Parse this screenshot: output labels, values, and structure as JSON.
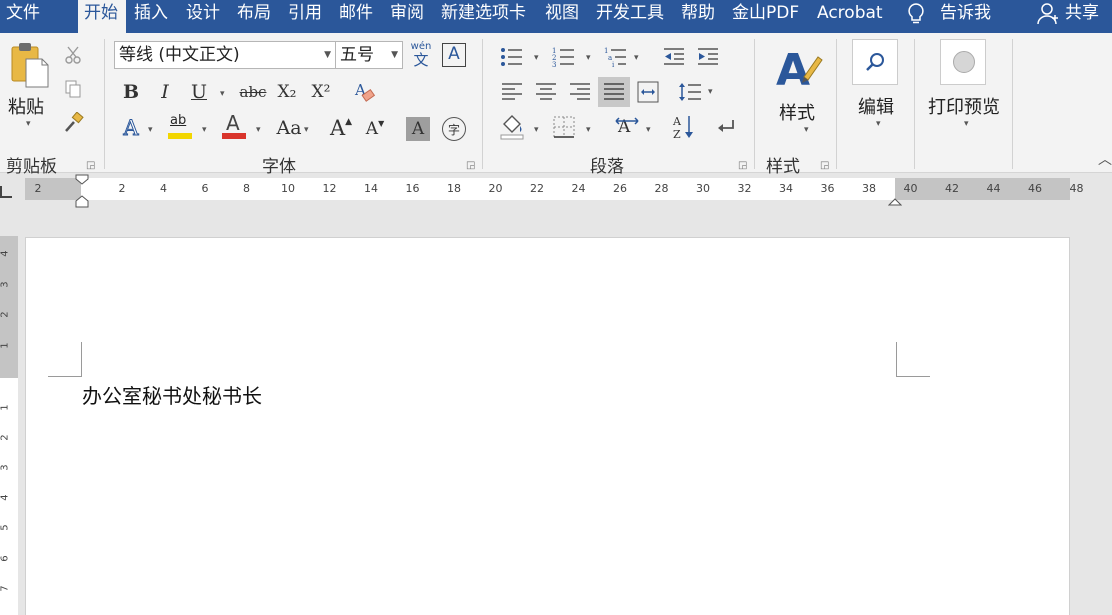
{
  "tabs": [
    {
      "label": "文件",
      "active": false
    },
    {
      "label": "开始",
      "active": true
    },
    {
      "label": "插入",
      "active": false
    },
    {
      "label": "设计",
      "active": false
    },
    {
      "label": "布局",
      "active": false
    },
    {
      "label": "引用",
      "active": false
    },
    {
      "label": "邮件",
      "active": false
    },
    {
      "label": "审阅",
      "active": false
    },
    {
      "label": "新建选项卡",
      "active": false
    },
    {
      "label": "视图",
      "active": false
    },
    {
      "label": "开发工具",
      "active": false
    },
    {
      "label": "帮助",
      "active": false
    },
    {
      "label": "金山PDF",
      "active": false
    },
    {
      "label": "Acrobat",
      "active": false
    }
  ],
  "tell_me": "告诉我",
  "share": "共享",
  "clipboard": {
    "paste": "粘贴",
    "group": "剪贴板"
  },
  "font": {
    "name": "等线 (中文正文)",
    "size": "五号",
    "phonetic_top": "wén",
    "phonetic_bottom": "文",
    "group": "字体",
    "bold": "B",
    "italic": "I",
    "underline": "U",
    "strike": "abc",
    "sub": "X₂",
    "sup": "X²",
    "highlight": "ab",
    "color": "A",
    "case": "Aa",
    "grow": "A",
    "shrink": "A",
    "shade": "A",
    "enclose": "字"
  },
  "paragraph": {
    "group": "段落"
  },
  "styles": {
    "label": "样式",
    "group": "样式"
  },
  "editing": {
    "label": "编辑"
  },
  "print_preview": {
    "label": "打印预览"
  },
  "ruler": {
    "h_numbers": [
      "2",
      "2",
      "4",
      "6",
      "8",
      "10",
      "12",
      "14",
      "16",
      "18",
      "20",
      "22",
      "24",
      "26",
      "28",
      "30",
      "32",
      "34",
      "36",
      "38",
      "40",
      "42",
      "44",
      "46",
      "48"
    ],
    "v_numbers": [
      "4",
      "3",
      "2",
      "1",
      "1",
      "2",
      "3",
      "4",
      "5",
      "6",
      "7"
    ]
  },
  "document": {
    "text": "办公室秘书处秘书长"
  },
  "colors": {
    "accent": "#2b579a",
    "highlight": "#f2d600",
    "font_color": "#d9342b"
  }
}
